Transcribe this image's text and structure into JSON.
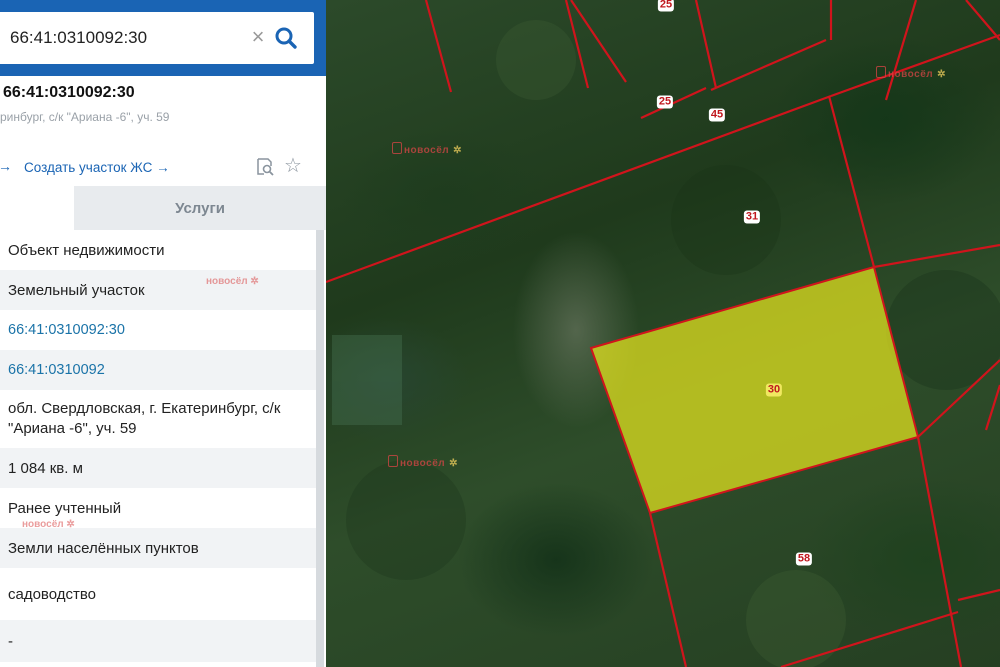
{
  "search": {
    "value": "66:41:0310092:30",
    "clear_icon": "×"
  },
  "object": {
    "title": "66:41:0310092:30",
    "subtitle": "ринбург, с/к \"Ариана -6\", уч. 59"
  },
  "actions": {
    "create_plot": "Создать участок ЖС →"
  },
  "tabs": {
    "services": "Услуги"
  },
  "rows": [
    "Объект недвижимости",
    "Земельный участок",
    "66:41:0310092:30",
    "66:41:0310092",
    "обл. Свердловская, г. Екатеринбург, с/к \"Ариана -6\", уч. 59",
    "1 084 кв. м",
    "Ранее учтенный",
    "Земли населённых пунктов",
    "садоводство",
    "-"
  ],
  "watermark": {
    "text": "новосёл"
  },
  "map": {
    "parcel_labels": [
      "25",
      "25",
      "45",
      "31",
      "30",
      "58"
    ],
    "selected_parcel": "30",
    "colors": {
      "boundary": "#d0141c",
      "selected_fill": "#e6e61e"
    }
  }
}
